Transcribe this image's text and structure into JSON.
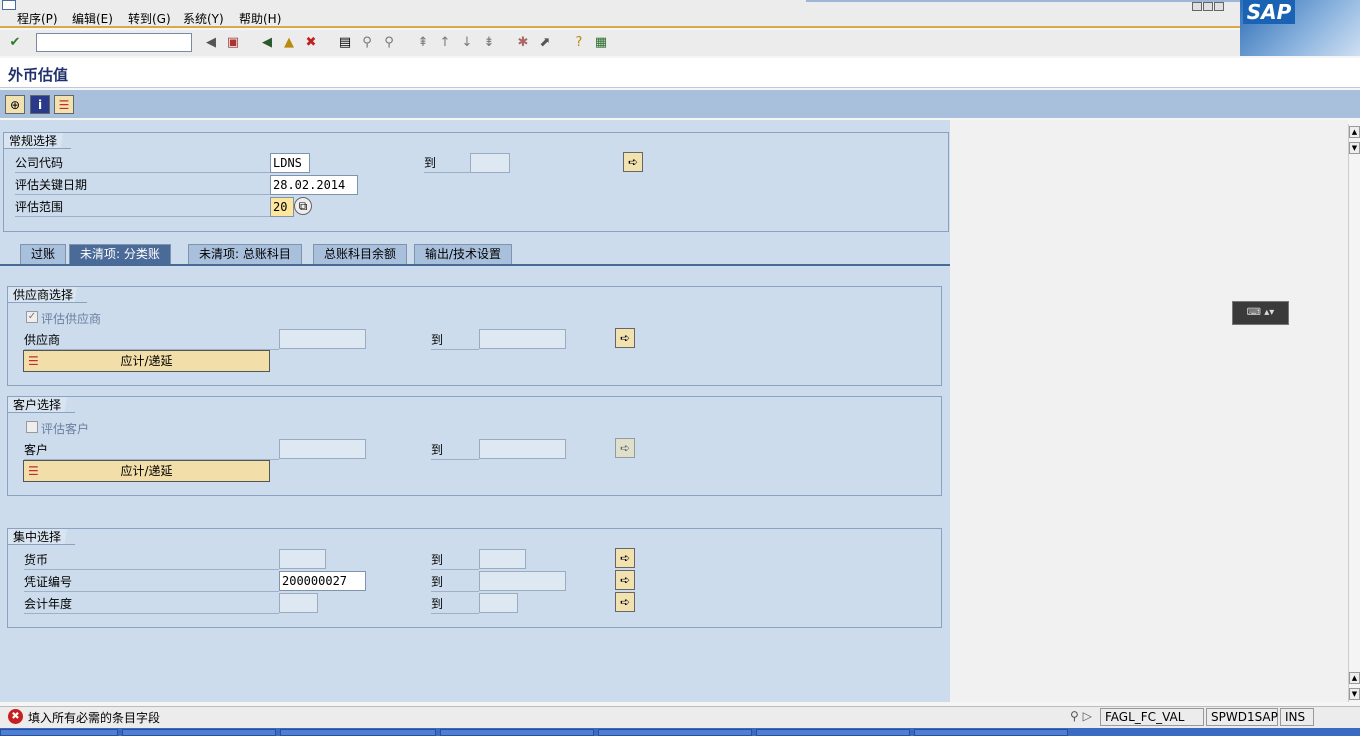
{
  "menu": [
    "程序(P)",
    "编辑(E)",
    "转到(G)",
    "系统(Y)",
    "帮助(H)"
  ],
  "logo": "SAP",
  "page_title": "外币估值",
  "general": {
    "title": "常规选择",
    "company_code_label": "公司代码",
    "company_code": "LDNS",
    "to_label": "到",
    "key_date_label": "评估关键日期",
    "key_date": "28.02.2014",
    "area_label": "评估范围",
    "area": "20"
  },
  "tabs": [
    "过账",
    "未清项: 分类账",
    "未清项: 总账科目",
    "总账科目余额",
    "输出/技术设置"
  ],
  "vendor": {
    "title": "供应商选择",
    "check_label": "评估供应商",
    "field_label": "供应商",
    "to_label": "到",
    "button": "应计/递延"
  },
  "customer": {
    "title": "客户选择",
    "check_label": "评估客户",
    "field_label": "客户",
    "to_label": "到",
    "button": "应计/递延"
  },
  "central": {
    "title": "集中选择",
    "currency_label": "货币",
    "doc_label": "凭证编号",
    "doc_value": "200000027",
    "year_label": "会计年度",
    "to_label": "到"
  },
  "status": {
    "message": "填入所有必需的条目字段",
    "tcode": "FAGL_FC_VAL",
    "system": "SPWD1SAP",
    "mode": "INS"
  }
}
